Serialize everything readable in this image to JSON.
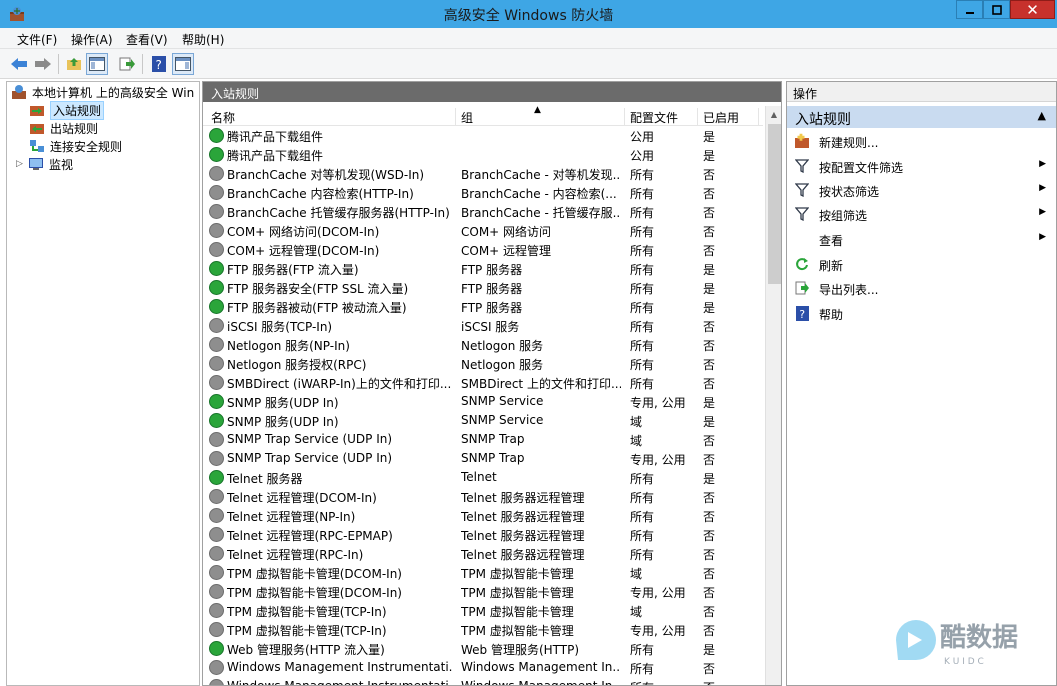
{
  "window": {
    "title": "高级安全 Windows 防火墙"
  },
  "menu": [
    "文件(F)",
    "操作(A)",
    "查看(V)",
    "帮助(H)"
  ],
  "tree": {
    "root": "本地计算机 上的高级安全 Win",
    "items": [
      "入站规则",
      "出站规则",
      "连接安全规则",
      "监视"
    ]
  },
  "center": {
    "title": "入站规则",
    "columns": [
      "名称",
      "组",
      "配置文件",
      "已启用"
    ],
    "rows": [
      {
        "name": "腾讯产品下载组件",
        "group": "",
        "profile": "公用",
        "enabled": "是",
        "on": true
      },
      {
        "name": "腾讯产品下载组件",
        "group": "",
        "profile": "公用",
        "enabled": "是",
        "on": true
      },
      {
        "name": "BranchCache 对等机发现(WSD-In)",
        "group": "BranchCache - 对等机发现...",
        "profile": "所有",
        "enabled": "否",
        "on": false
      },
      {
        "name": "BranchCache 内容检索(HTTP-In)",
        "group": "BranchCache - 内容检索(...",
        "profile": "所有",
        "enabled": "否",
        "on": false
      },
      {
        "name": "BranchCache 托管缓存服务器(HTTP-In)",
        "group": "BranchCache - 托管缓存服...",
        "profile": "所有",
        "enabled": "否",
        "on": false
      },
      {
        "name": "COM+ 网络访问(DCOM-In)",
        "group": "COM+ 网络访问",
        "profile": "所有",
        "enabled": "否",
        "on": false
      },
      {
        "name": "COM+ 远程管理(DCOM-In)",
        "group": "COM+ 远程管理",
        "profile": "所有",
        "enabled": "否",
        "on": false
      },
      {
        "name": "FTP 服务器(FTP 流入量)",
        "group": "FTP 服务器",
        "profile": "所有",
        "enabled": "是",
        "on": true
      },
      {
        "name": "FTP 服务器安全(FTP SSL 流入量)",
        "group": "FTP 服务器",
        "profile": "所有",
        "enabled": "是",
        "on": true
      },
      {
        "name": "FTP 服务器被动(FTP 被动流入量)",
        "group": "FTP 服务器",
        "profile": "所有",
        "enabled": "是",
        "on": true
      },
      {
        "name": "iSCSI 服务(TCP-In)",
        "group": "iSCSI 服务",
        "profile": "所有",
        "enabled": "否",
        "on": false
      },
      {
        "name": "Netlogon 服务(NP-In)",
        "group": "Netlogon 服务",
        "profile": "所有",
        "enabled": "否",
        "on": false
      },
      {
        "name": "Netlogon 服务授权(RPC)",
        "group": "Netlogon 服务",
        "profile": "所有",
        "enabled": "否",
        "on": false
      },
      {
        "name": "SMBDirect (iWARP-In)上的文件和打印...",
        "group": "SMBDirect 上的文件和打印...",
        "profile": "所有",
        "enabled": "否",
        "on": false
      },
      {
        "name": "SNMP 服务(UDP In)",
        "group": "SNMP Service",
        "profile": "专用, 公用",
        "enabled": "是",
        "on": true
      },
      {
        "name": "SNMP 服务(UDP In)",
        "group": "SNMP Service",
        "profile": "域",
        "enabled": "是",
        "on": true
      },
      {
        "name": "SNMP Trap Service (UDP In)",
        "group": "SNMP Trap",
        "profile": "域",
        "enabled": "否",
        "on": false
      },
      {
        "name": "SNMP Trap Service (UDP In)",
        "group": "SNMP Trap",
        "profile": "专用, 公用",
        "enabled": "否",
        "on": false
      },
      {
        "name": "Telnet 服务器",
        "group": "Telnet",
        "profile": "所有",
        "enabled": "是",
        "on": true
      },
      {
        "name": "Telnet 远程管理(DCOM-In)",
        "group": "Telnet 服务器远程管理",
        "profile": "所有",
        "enabled": "否",
        "on": false
      },
      {
        "name": "Telnet 远程管理(NP-In)",
        "group": "Telnet 服务器远程管理",
        "profile": "所有",
        "enabled": "否",
        "on": false
      },
      {
        "name": "Telnet 远程管理(RPC-EPMAP)",
        "group": "Telnet 服务器远程管理",
        "profile": "所有",
        "enabled": "否",
        "on": false
      },
      {
        "name": "Telnet 远程管理(RPC-In)",
        "group": "Telnet 服务器远程管理",
        "profile": "所有",
        "enabled": "否",
        "on": false
      },
      {
        "name": "TPM 虚拟智能卡管理(DCOM-In)",
        "group": "TPM 虚拟智能卡管理",
        "profile": "域",
        "enabled": "否",
        "on": false
      },
      {
        "name": "TPM 虚拟智能卡管理(DCOM-In)",
        "group": "TPM 虚拟智能卡管理",
        "profile": "专用, 公用",
        "enabled": "否",
        "on": false
      },
      {
        "name": "TPM 虚拟智能卡管理(TCP-In)",
        "group": "TPM 虚拟智能卡管理",
        "profile": "域",
        "enabled": "否",
        "on": false
      },
      {
        "name": "TPM 虚拟智能卡管理(TCP-In)",
        "group": "TPM 虚拟智能卡管理",
        "profile": "专用, 公用",
        "enabled": "否",
        "on": false
      },
      {
        "name": "Web 管理服务(HTTP 流入量)",
        "group": "Web 管理服务(HTTP)",
        "profile": "所有",
        "enabled": "是",
        "on": true
      },
      {
        "name": "Windows Management Instrumentati...",
        "group": "Windows Management In...",
        "profile": "所有",
        "enabled": "否",
        "on": false
      },
      {
        "name": "Windows Management Instrumentati...",
        "group": "Windows Management In...",
        "profile": "所有",
        "enabled": "否",
        "on": false
      }
    ]
  },
  "actions": {
    "title": "操作",
    "section": "入站规则",
    "items": [
      {
        "label": "新建规则...",
        "icon": "new-rule-icon",
        "submenu": false
      },
      {
        "label": "按配置文件筛选",
        "icon": "filter-icon",
        "submenu": true
      },
      {
        "label": "按状态筛选",
        "icon": "filter-icon",
        "submenu": true
      },
      {
        "label": "按组筛选",
        "icon": "filter-icon",
        "submenu": true
      },
      {
        "label": "查看",
        "icon": "",
        "submenu": true
      },
      {
        "label": "刷新",
        "icon": "refresh-icon",
        "submenu": false
      },
      {
        "label": "导出列表...",
        "icon": "export-icon",
        "submenu": false
      },
      {
        "label": "帮助",
        "icon": "help-icon",
        "submenu": false
      }
    ]
  },
  "watermark": {
    "text": "酷数据",
    "sub": "K U I D C"
  },
  "colors": {
    "titlebar": "#3ea6e5",
    "enabled": "#2aa53a",
    "disabled": "#8e8e8e",
    "section": "#c9dbf0",
    "header": "#6b6b6b"
  }
}
